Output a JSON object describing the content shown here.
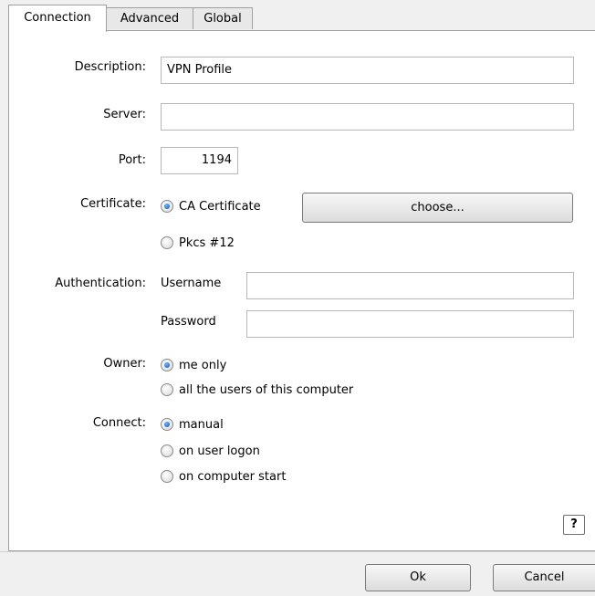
{
  "tabs": [
    "Connection",
    "Advanced",
    "Global"
  ],
  "labels": {
    "description": "Description:",
    "server": "Server:",
    "port": "Port:",
    "certificate": "Certificate:",
    "authentication": "Authentication:",
    "owner": "Owner:",
    "connect": "Connect:"
  },
  "fields": {
    "description_value": "VPN Profile",
    "server_value": "",
    "port_value": "1194",
    "username_label": "Username",
    "username_value": "",
    "password_label": "Password",
    "password_value": ""
  },
  "certificate": {
    "options": [
      "CA Certificate",
      "Pkcs #12"
    ],
    "selected": "CA Certificate",
    "choose_label": "choose..."
  },
  "owner": {
    "options": [
      "me only",
      "all the users of this computer"
    ],
    "selected": "me only"
  },
  "connect": {
    "options": [
      "manual",
      "on user logon",
      "on computer start"
    ],
    "selected": "manual"
  },
  "help_label": "?",
  "buttons": {
    "ok": "Ok",
    "cancel": "Cancel"
  }
}
